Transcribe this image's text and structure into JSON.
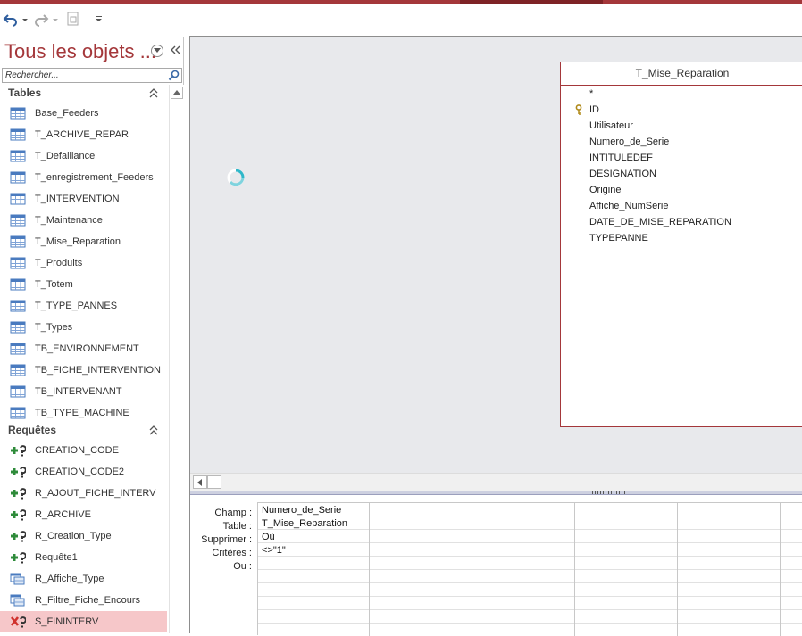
{
  "nav": {
    "title": "Tous les objets ...",
    "search_placeholder": "Rechercher...",
    "groups": {
      "tables": {
        "label": "Tables",
        "items": [
          "Base_Feeders",
          "T_ARCHIVE_REPAR",
          "T_Defaillance",
          "T_enregistrement_Feeders",
          "T_INTERVENTION",
          "T_Maintenance",
          "T_Mise_Reparation",
          "T_Produits",
          "T_Totem",
          "T_TYPE_PANNES",
          "T_Types",
          "TB_ENVIRONNEMENT",
          "TB_FICHE_INTERVENTION",
          "TB_INTERVENANT",
          "TB_TYPE_MACHINE"
        ]
      },
      "queries": {
        "label": "Requêtes",
        "items": [
          "CREATION_CODE",
          "CREATION_CODE2",
          "R_AJOUT_FICHE_INTERV",
          "R_ARCHIVE",
          "R_Creation_Type",
          "Requête1",
          "R_Affiche_Type",
          "R_Filtre_Fiche_Encours",
          "S_FININTERV"
        ]
      }
    }
  },
  "field_list": {
    "title": "T_Mise_Reparation",
    "fields": [
      "*",
      "ID",
      "Utilisateur",
      "Numero_de_Serie",
      "INTITULEDEF",
      "DESIGNATION",
      "Origine",
      "Affiche_NumSerie",
      "DATE_DE_MISE_REPARATION",
      "TYPEPANNE"
    ]
  },
  "grid": {
    "row_labels": [
      "Champ :",
      "Table :",
      "Supprimer :",
      "Critères :",
      "Ou :"
    ],
    "column1": {
      "field": "Numero_de_Serie",
      "table": "T_Mise_Reparation",
      "delete": "Où",
      "criteria": "<>\"1\""
    }
  },
  "colors": {
    "accent": "#a4373a",
    "selected": "#f6c7c9",
    "designer_bg": "#e8e9ec"
  },
  "icons": {
    "undo": "undo-icon",
    "redo": "redo-icon",
    "table": "table-icon",
    "append_query": "append-query-icon",
    "select_query": "select-query-icon",
    "delete_query": "delete-query-icon",
    "primary_key": "key-icon",
    "loading": "loading-spinner-icon"
  }
}
